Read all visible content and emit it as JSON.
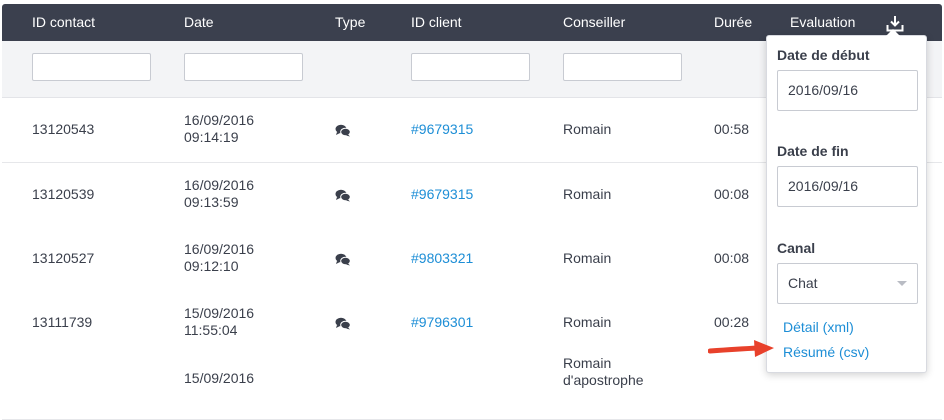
{
  "table": {
    "headers": {
      "id_contact": "ID contact",
      "date": "Date",
      "type": "Type",
      "id_client": "ID client",
      "conseiller": "Conseiller",
      "duree": "Durée",
      "evaluation": "Evaluation"
    },
    "rows": [
      {
        "id_contact": "13120543",
        "date_line1": "16/09/2016",
        "date_line2": "09:14:19",
        "type_icon": "chat-icon",
        "id_client": "#9679315",
        "conseiller": "Romain",
        "duree": "00:58"
      },
      {
        "id_contact": "13120539",
        "date_line1": "16/09/2016",
        "date_line2": "09:13:59",
        "type_icon": "chat-icon",
        "id_client": "#9679315",
        "conseiller": "Romain",
        "duree": "00:08"
      },
      {
        "id_contact": "13120527",
        "date_line1": "16/09/2016",
        "date_line2": "09:12:10",
        "type_icon": "chat-icon",
        "id_client": "#9803321",
        "conseiller": "Romain",
        "duree": "00:08"
      },
      {
        "id_contact": "13111739",
        "date_line1": "15/09/2016",
        "date_line2": "11:55:04",
        "type_icon": "chat-icon",
        "id_client": "#9796301",
        "conseiller": "Romain",
        "duree": "00:28"
      },
      {
        "id_contact": "",
        "date_line1": "15/09/2016",
        "date_line2": "",
        "type_icon": "chat-icon",
        "id_client": "",
        "conseiller_line1": "Romain",
        "conseiller_line2": "d'apostrophe",
        "duree": ""
      }
    ]
  },
  "export_popover": {
    "start_date_label": "Date de début",
    "start_date_value": "2016/09/16",
    "end_date_label": "Date de fin",
    "end_date_value": "2016/09/16",
    "channel_label": "Canal",
    "channel_value": "Chat",
    "detail_link": "Détail (xml)",
    "summary_link": "Résumé (csv)"
  },
  "icons": {
    "download": "download-icon",
    "chat": "chat-icon",
    "arrow": "red-arrow-annotation"
  },
  "colors": {
    "header_bg": "#3b404e",
    "link": "#1d8ed6",
    "arrow": "#e8412b"
  }
}
